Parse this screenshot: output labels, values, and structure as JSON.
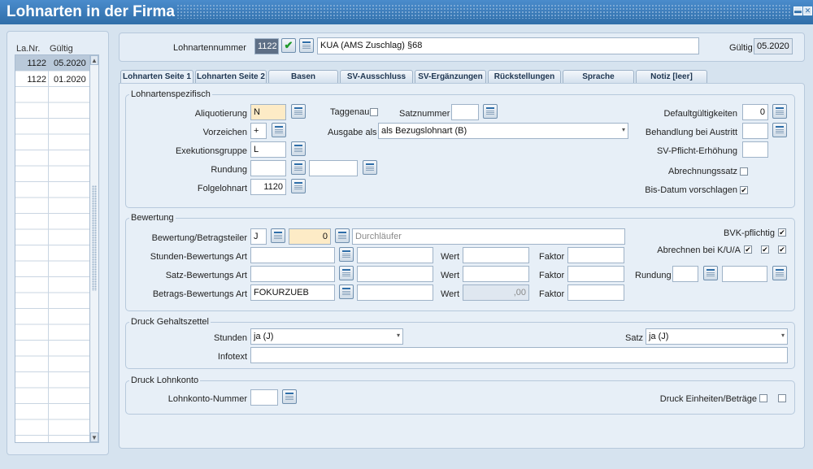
{
  "window": {
    "title": "Lohnarten in der Firma"
  },
  "list": {
    "headers": {
      "nr": "La.Nr.",
      "gueltig": "Gültig"
    },
    "rows": [
      {
        "nr": "1122",
        "date": "05.2020"
      },
      {
        "nr": "1122",
        "date": "01.2020"
      }
    ]
  },
  "header": {
    "nummer_label": "Lohnartennummer",
    "nummer_value": "1122",
    "name_value": "KUA  (AMS Zuschlag) §68",
    "gueltig_label": "Gültig",
    "gueltig_value": "05.2020"
  },
  "tabs": [
    "Lohnarten Seite 1",
    "Lohnarten Seite 2",
    "Basen",
    "SV-Ausschluss",
    "SV-Ergänzungen",
    "Rückstellungen",
    "Sprache",
    "Notiz [leer]"
  ],
  "lohnartenspezifisch": {
    "title": "Lohnartenspezifisch",
    "aliquotierung_label": "Aliquotierung",
    "aliquotierung_value": "N",
    "vorzeichen_label": "Vorzeichen",
    "vorzeichen_value": "+",
    "exekution_label": "Exekutionsgruppe",
    "exekution_value": "L",
    "rundung_label": "Rundung",
    "folgelohnart_label": "Folgelohnart",
    "folgelohnart_value": "1120",
    "taggenau_label": "Taggenau",
    "satznummer_label": "Satznummer",
    "ausgabe_label": "Ausgabe als",
    "ausgabe_value": "als Bezugslohnart (B)",
    "default_label": "Defaultgültigkeiten",
    "default_value": "0",
    "austritt_label": "Behandlung bei Austritt",
    "svpflicht_label": "SV-Pflicht-Erhöhung",
    "abrechnungssatz_label": "Abrechnungssatz",
    "bisdatum_label": "Bis-Datum vorschlagen"
  },
  "bewertung": {
    "title": "Bewertung",
    "betragsteiler_label": "Bewertung/Betragsteiler",
    "betragsteiler_value": "J",
    "betragsteiler_num": "0",
    "betragsteiler_desc": "Durchläufer",
    "stunden_label": "Stunden-Bewertungs Art",
    "satz_label": "Satz-Bewertungs Art",
    "betrag_label": "Betrags-Bewertungs Art",
    "betrag_value": "FOKURZUEB",
    "wert_label": "Wert",
    "faktor_label": "Faktor",
    "betrag_wert_value": ",00",
    "bvk_label": "BVK-pflichtig",
    "abrechnen_label": "Abrechnen bei K/U/A",
    "rundung_label": "Rundung"
  },
  "druck_gehalt": {
    "title": "Druck Gehaltszettel",
    "stunden_label": "Stunden",
    "stunden_value": "ja (J)",
    "satz_label": "Satz",
    "satz_value": "ja (J)",
    "infotext_label": "Infotext"
  },
  "druck_lohnkonto": {
    "title": "Druck Lohnkonto",
    "nummer_label": "Lohnkonto-Nummer",
    "einheiten_label": "Druck Einheiten/Beträge"
  },
  "check_glyph": "✔",
  "dropdown_glyph": "▾",
  "colors": {
    "titlebar": "#3d7fbd",
    "required_field": "#fdebc6",
    "selected_row": "#b9c9da"
  }
}
